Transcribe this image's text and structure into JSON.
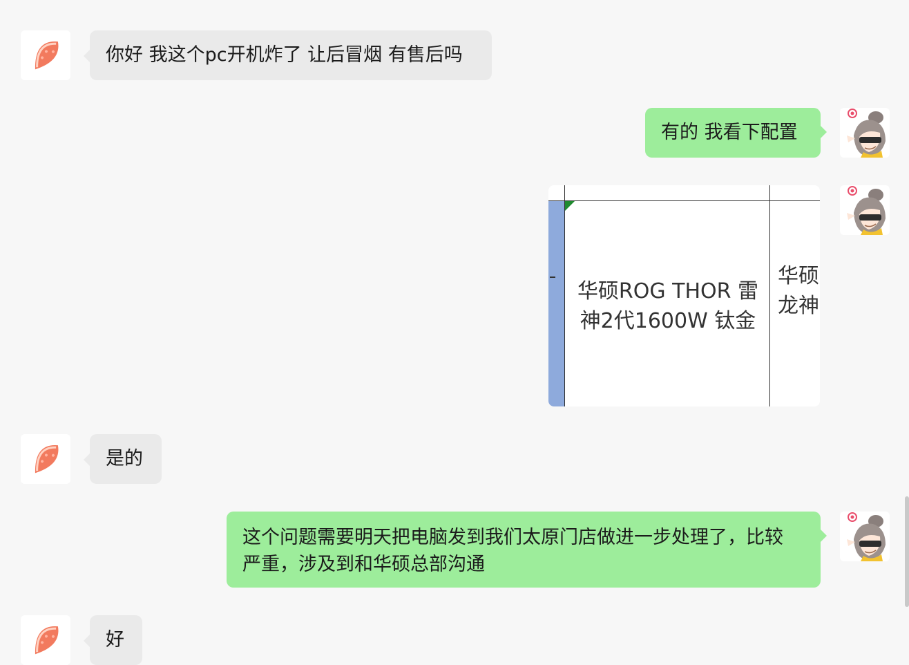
{
  "messages": [
    {
      "side": "in",
      "text": "你好 我这个pc开机炸了 让后冒烟 有售后吗"
    },
    {
      "side": "out",
      "text": "有的 我看下配置"
    },
    {
      "side": "out",
      "type": "image",
      "cells": [
        "华硕ROG THOR 雷\n神2代1600W 钛金",
        "华硕\n龙神"
      ]
    },
    {
      "side": "in",
      "text": "是的"
    },
    {
      "side": "out",
      "text": "这个问题需要明天把电脑发到我们太原门店做进一步处理了，比较\n严重，涉及到和华硕总部沟通"
    },
    {
      "side": "in",
      "text": "好"
    }
  ],
  "avatars": {
    "customer": "grapefruit-avatar-icon",
    "agent": "anime-girl-avatar-icon"
  },
  "colors": {
    "background": "#f7f7f7",
    "incoming_bubble": "#eaeaea",
    "outgoing_bubble": "#9ded9b"
  }
}
